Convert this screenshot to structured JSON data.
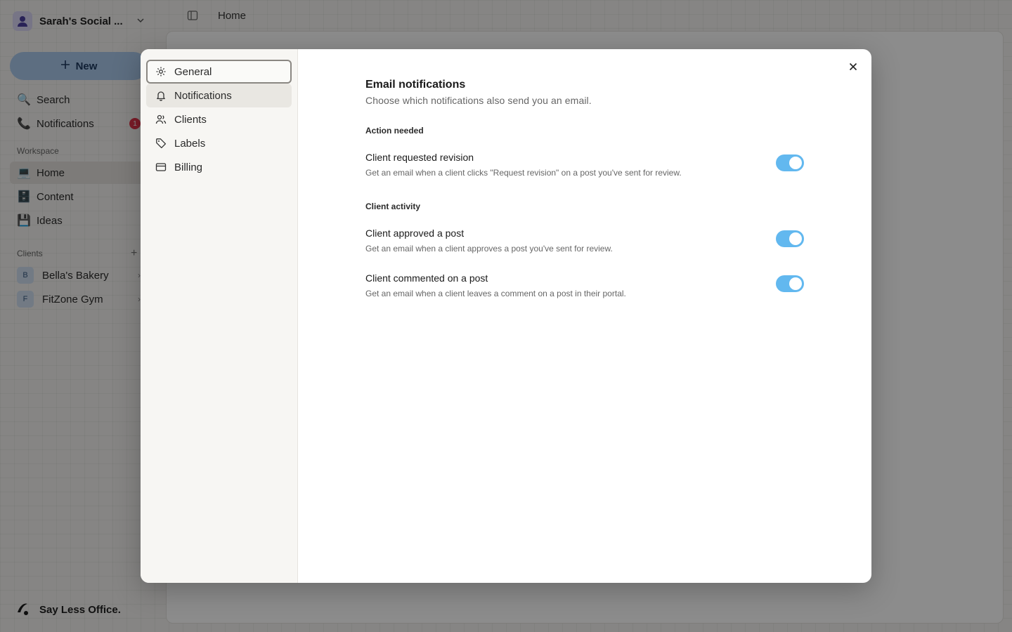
{
  "app": {
    "workspace_name": "Sarah's Social ...",
    "new_label": "New",
    "nav": [
      {
        "label": "Search",
        "icon": "magnifier-icon"
      },
      {
        "label": "Notifications",
        "icon": "phone-icon",
        "badge": "1"
      }
    ],
    "workspace_section": "Workspace",
    "workspace_items": [
      {
        "label": "Home",
        "icon": "computer-icon"
      },
      {
        "label": "Content",
        "icon": "file-cabinet-icon"
      },
      {
        "label": "Ideas",
        "icon": "floppy-disk-icon"
      }
    ],
    "clients_section": "Clients",
    "clients": [
      {
        "initial": "B",
        "label": "Bella's Bakery"
      },
      {
        "initial": "F",
        "label": "FitZone Gym"
      }
    ],
    "brand": "Say Less Office.",
    "breadcrumb": "Home"
  },
  "settings": {
    "menu": [
      {
        "label": "General",
        "icon": "gear-icon"
      },
      {
        "label": "Notifications",
        "icon": "bell-icon"
      },
      {
        "label": "Clients",
        "icon": "users-icon"
      },
      {
        "label": "Labels",
        "icon": "tag-icon"
      },
      {
        "label": "Billing",
        "icon": "credit-card-icon"
      }
    ],
    "title": "Email notifications",
    "subtitle": "Choose which notifications also send you an email.",
    "groups": [
      {
        "label": "Action needed",
        "rows": [
          {
            "title": "Client requested revision",
            "desc": "Get an email when a client clicks \"Request revision\" on a post you've sent for review.",
            "enabled": true
          }
        ]
      },
      {
        "label": "Client activity",
        "rows": [
          {
            "title": "Client approved a post",
            "desc": "Get an email when a client approves a post you've sent for review.",
            "enabled": true
          },
          {
            "title": "Client commented on a post",
            "desc": "Get an email when a client leaves a comment on a post in their portal.",
            "enabled": true
          }
        ]
      }
    ],
    "accent": "#62b8ef"
  }
}
